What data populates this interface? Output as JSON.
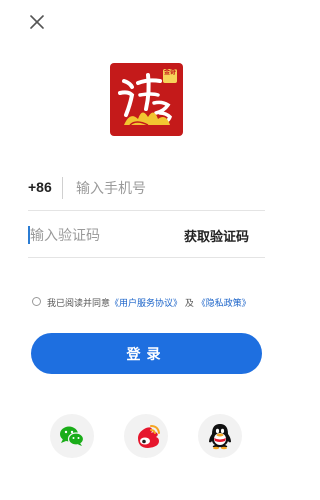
{
  "colors": {
    "primary": "#1e6fe0",
    "link": "#1a63c9",
    "logo_red": "#c41a1a",
    "wechat_green": "#1aad19",
    "weibo_red": "#e6162d"
  },
  "close": {
    "icon": "close-icon"
  },
  "logo": {
    "stamp_text": "金奇"
  },
  "phone": {
    "country_code": "+86",
    "placeholder": "输入手机号",
    "value": ""
  },
  "code": {
    "placeholder": "输入验证码",
    "value": "",
    "get_code_label": "获取验证码"
  },
  "agreement": {
    "checked": false,
    "prefix": "我已阅读并同意",
    "user_agreement": "《用户服务协议》",
    "joiner": "及",
    "privacy_policy": "《隐私政策》"
  },
  "login": {
    "label": "登录"
  },
  "social": [
    {
      "icon": "wechat-icon"
    },
    {
      "icon": "weibo-icon"
    },
    {
      "icon": "qq-icon"
    }
  ]
}
